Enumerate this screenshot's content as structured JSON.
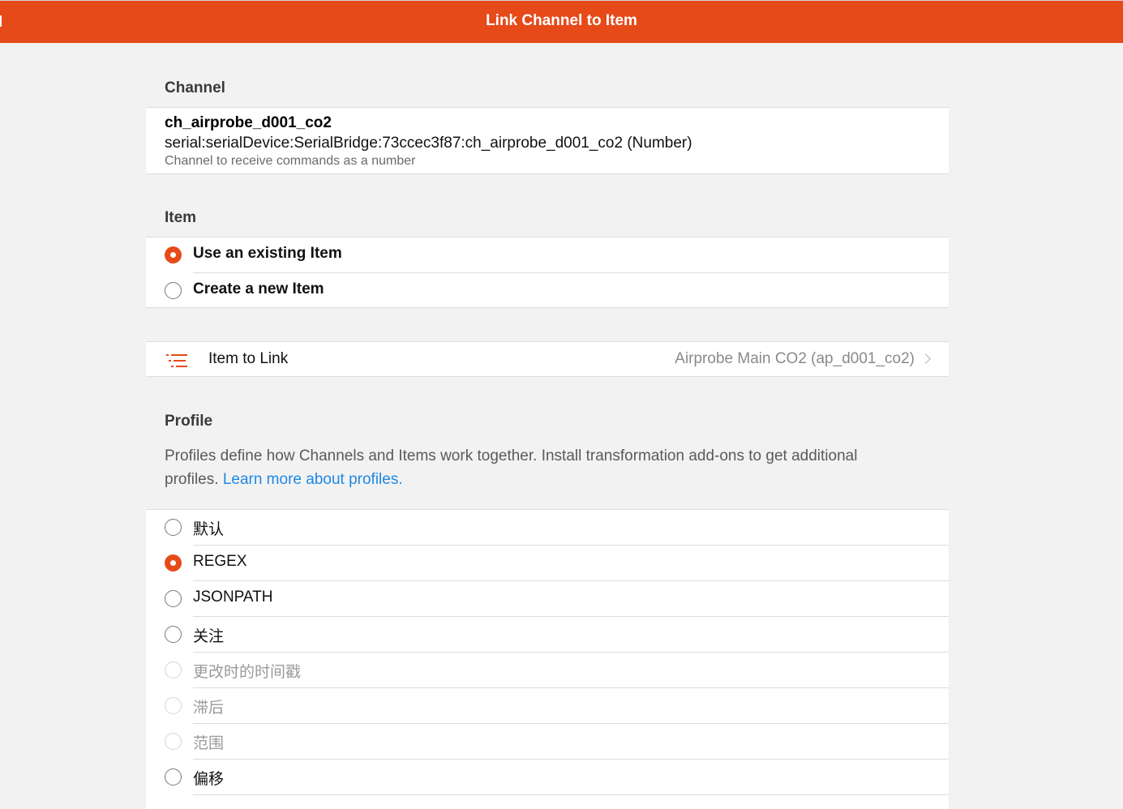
{
  "navbar": {
    "title": "Link Channel to Item"
  },
  "channel": {
    "section_title": "Channel",
    "label": "ch_airprobe_d001_co2",
    "uid": "serial:serialDevice:SerialBridge:73ccec3f87:ch_airprobe_d001_co2 (Number)",
    "description": "Channel to receive commands as a number"
  },
  "item": {
    "section_title": "Item",
    "options": [
      {
        "label": "Use an existing Item",
        "checked": true
      },
      {
        "label": "Create a new Item",
        "checked": false
      }
    ],
    "link": {
      "icon": "list-icon",
      "label": "Item to Link",
      "value": "Airprobe Main CO2 (ap_d001_co2)"
    }
  },
  "profile": {
    "section_title": "Profile",
    "description": "Profiles define how Channels and Items work together. Install transformation add-ons to get additional profiles.",
    "learn_more": "Learn more about profiles.",
    "options": [
      {
        "label": "默认",
        "checked": false,
        "disabled": false
      },
      {
        "label": "REGEX",
        "checked": true,
        "disabled": false
      },
      {
        "label": "JSONPATH",
        "checked": false,
        "disabled": false
      },
      {
        "label": "关注",
        "checked": false,
        "disabled": false
      },
      {
        "label": "更改时的时间戳",
        "checked": false,
        "disabled": true
      },
      {
        "label": "滞后",
        "checked": false,
        "disabled": true
      },
      {
        "label": "范围",
        "checked": false,
        "disabled": true
      },
      {
        "label": "偏移",
        "checked": false,
        "disabled": false
      }
    ]
  },
  "colors": {
    "accent": "#e64a19",
    "link": "#1e88e5"
  }
}
